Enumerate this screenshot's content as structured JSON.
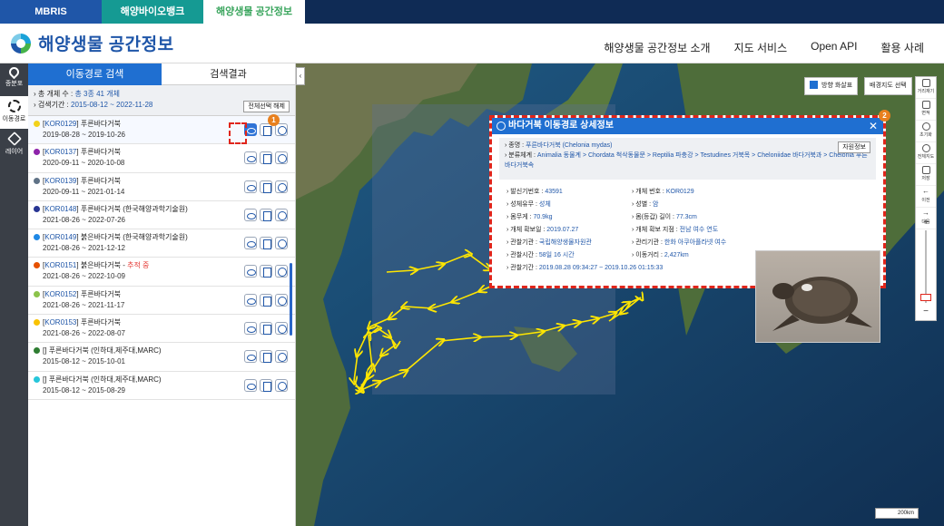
{
  "top_tabs": [
    "MBRIS",
    "해양바이오뱅크",
    "해양생물 공간정보"
  ],
  "site_title": "해양생물 공간정보",
  "gnb": [
    "해양생물 공간정보 소개",
    "지도 서비스",
    "Open API",
    "활용 사례"
  ],
  "rail": [
    {
      "label": "종분포",
      "icon": "map-pin-icon"
    },
    {
      "label": "이동경로",
      "icon": "route-icon"
    },
    {
      "label": "레이어",
      "icon": "layers-icon"
    }
  ],
  "panel": {
    "tabs": [
      "이동경로 검색",
      "검색결과"
    ],
    "summary_label1": "총 개체 수 :",
    "summary_value1": "총 3종 41 개체",
    "summary_label2": "검색기간 :",
    "summary_value2": "2015-08-12 ~ 2022-11-28",
    "deselect_label": "전체선택 해제",
    "rows": [
      {
        "code": "KOR0129",
        "name": " 푸른바다거북",
        "extra": "",
        "date": "2019-08-28 ~ 2019-10-26",
        "color": "#f2d21b"
      },
      {
        "code": "KOR0137",
        "name": " 푸른바다거북",
        "extra": "",
        "date": "2020-09-11 ~ 2020-10-08",
        "color": "#8e24aa"
      },
      {
        "code": "KOR0139",
        "name": " 푸른바다거북",
        "extra": "",
        "date": "2020-09-11 ~ 2021-01-14",
        "color": "#5f7286"
      },
      {
        "code": "KOR0148",
        "name": " 푸른바다거북 (한국해양과학기술원)",
        "extra": "",
        "date": "2021-08-26 ~ 2022-07-26",
        "color": "#283593"
      },
      {
        "code": "KOR0149",
        "name": " 붉은바다거북 (한국해양과학기술원)",
        "extra": "",
        "date": "2021-08-26 ~ 2021-12-12",
        "color": "#1e88e5"
      },
      {
        "code": "KOR0151",
        "name": " 붉은바다거북 - ",
        "extra": "추적 중",
        "date": "2021-08-26 ~ 2022-10-09",
        "color": "#e65100"
      },
      {
        "code": "KOR0152",
        "name": " 푸른바다거북",
        "extra": "",
        "date": "2021-08-26 ~ 2021-11-17",
        "color": "#8bc34a"
      },
      {
        "code": "KOR0153",
        "name": " 푸른바다거북",
        "extra": "",
        "date": "2021-08-26 ~ 2022-08-07",
        "color": "#f9c200"
      },
      {
        "code": "",
        "name": " 푸른바다거북 (인하대,제주대,MARC)",
        "extra": "",
        "date": "2015-08-12 ~ 2015-10-01",
        "color": "#2e7d32"
      },
      {
        "code": "",
        "name": " 푸른바다거북 (인하대,제주대,MARC)",
        "extra": "",
        "date": "2015-08-12 ~ 2015-08-29",
        "color": "#26c6da"
      }
    ]
  },
  "markers": [
    "1",
    "2"
  ],
  "map_controls": {
    "direction_label": "방향 화살표",
    "basemap_label": "배경지도 선택"
  },
  "toolbar": [
    "거리재기",
    "면적",
    "초기화",
    "전체지도",
    "저장",
    "이전",
    "다음"
  ],
  "scale": "200km",
  "popup": {
    "title": "바다거북 이동경로 상세정보",
    "close": "✕",
    "species_label": "종명 :",
    "species_value": "푸른바다거북 (Chelonia mydas)",
    "resource_btn": "자원정보",
    "taxonomy_label": "분류체계 :",
    "taxonomy_value": "Animalia 동물계 > Chordata 척삭동물문 > Reptilia 파충강 > Testudines 거북목 > Cheloniidae 바다거북과 > Chelonia 푸른바다거북속",
    "fields": [
      {
        "label": "발신기번호 :",
        "value": "43591"
      },
      {
        "label": "개체 번호 :",
        "value": "KOR0129"
      },
      {
        "label": "성체유무 :",
        "value": "성체"
      },
      {
        "label": "성별 :",
        "value": "암"
      },
      {
        "label": "몸무게 :",
        "value": "70.9kg"
      },
      {
        "label": "몸(등갑) 길이 :",
        "value": "77.3cm"
      },
      {
        "label": "개체 확보일 :",
        "value": "2019.07.27"
      },
      {
        "label": "개체 확보 지점 :",
        "value": "전남 여수 연도"
      },
      {
        "label": "관찰기관 :",
        "value": "국립해양생물자원관"
      },
      {
        "label": "관리기관 :",
        "value": "한화 아쿠아플라넷 여수"
      },
      {
        "label": "관찰시간 :",
        "value": "58일 16 시간"
      },
      {
        "label": "이동거리 :",
        "value": "2,427km"
      }
    ],
    "period_label": "관찰기간 :",
    "period_value": "2019.08.28 09:34:27 ~ 2019.10.26 01:15:33"
  }
}
